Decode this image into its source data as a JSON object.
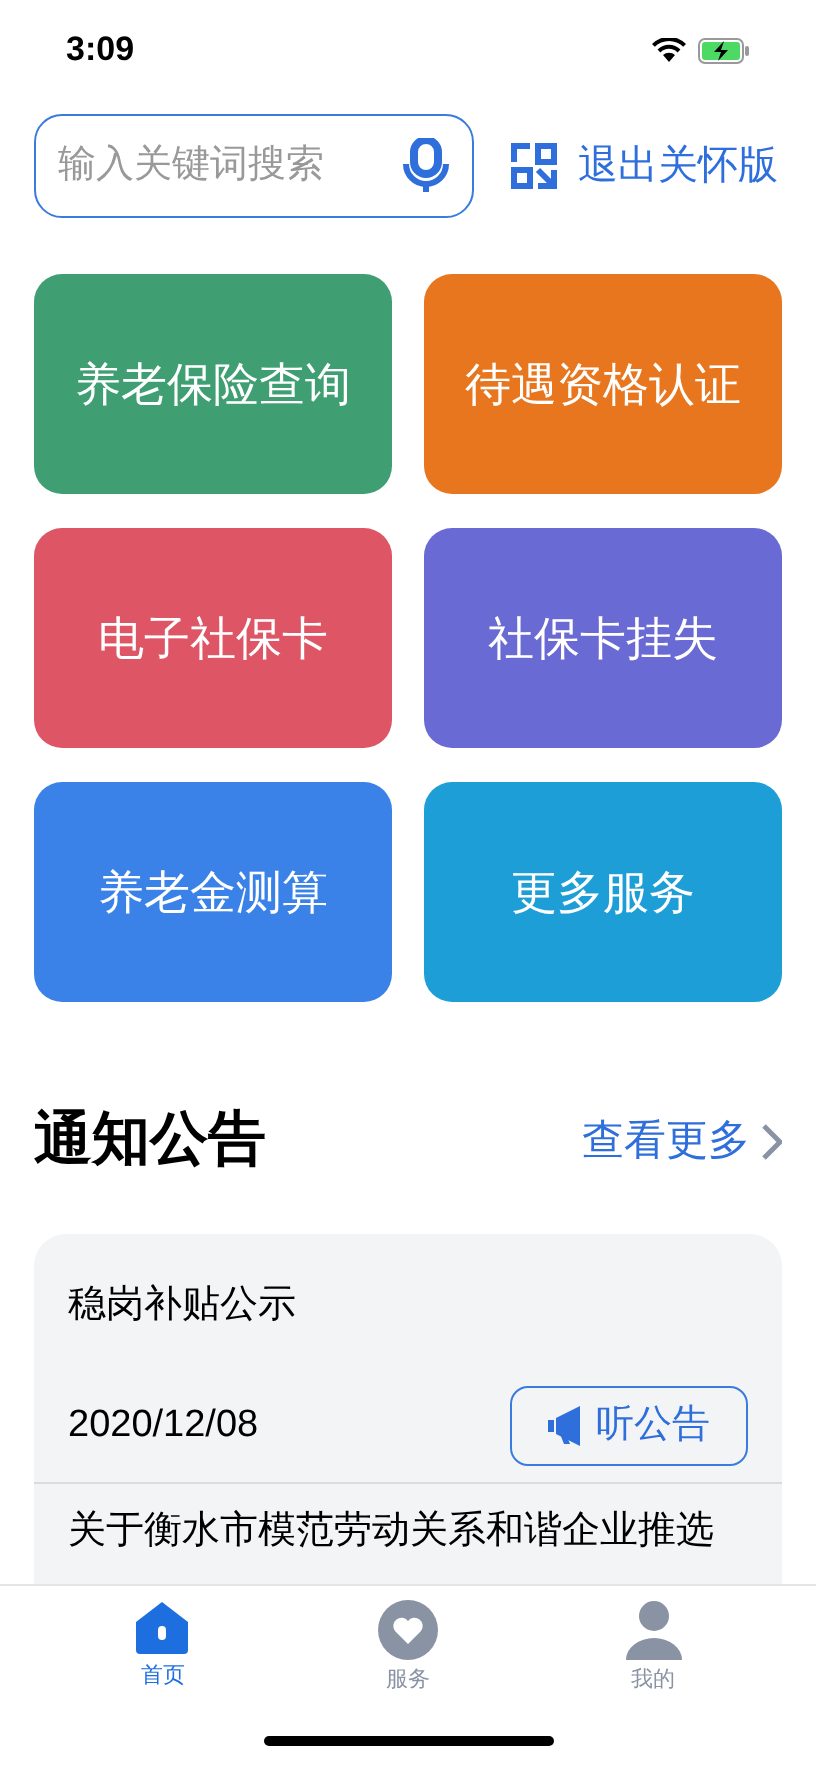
{
  "status_bar": {
    "time": "3:09"
  },
  "search": {
    "placeholder": "输入关键词搜索"
  },
  "exit_care_mode": "退出关怀版",
  "services": [
    {
      "label": "养老保险查询",
      "color": "#3f9e72"
    },
    {
      "label": "待遇资格认证",
      "color": "#e8761f"
    },
    {
      "label": "电子社保卡",
      "color": "#de5566"
    },
    {
      "label": "社保卡挂失",
      "color": "#6a6ad4"
    },
    {
      "label": "养老金测算",
      "color": "#3a82e8"
    },
    {
      "label": "更多服务",
      "color": "#1e9ed6"
    }
  ],
  "notices": {
    "title": "通知公告",
    "more": "查看更多",
    "items": [
      {
        "title": "稳岗补贴公示",
        "date": "2020/12/08",
        "listen": "听公告"
      },
      {
        "title": "关于衡水市模范劳动关系和谐企业推选"
      }
    ]
  },
  "tab_bar": [
    {
      "label": "首页",
      "selected": true,
      "kind": "home"
    },
    {
      "label": "服务",
      "selected": false,
      "kind": "service"
    },
    {
      "label": "我的",
      "selected": false,
      "kind": "profile"
    }
  ]
}
